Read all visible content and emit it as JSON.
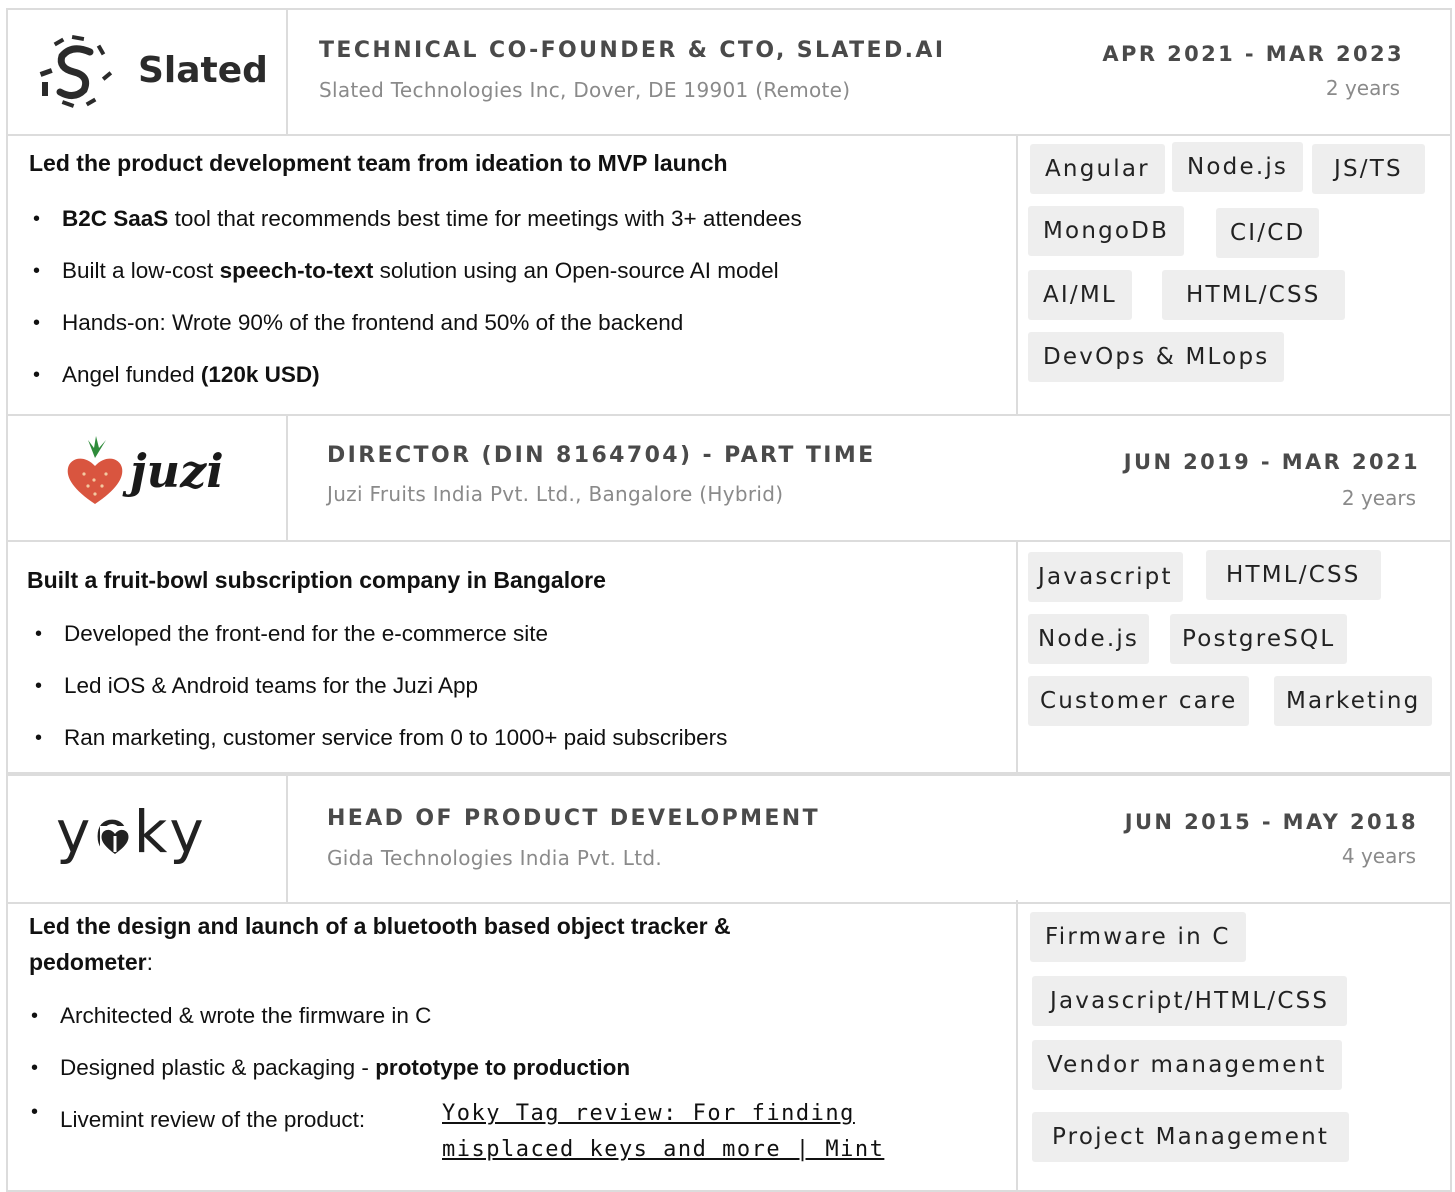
{
  "jobs": [
    {
      "logo_text": "Slated",
      "title": "TECHNICAL CO-FOUNDER & CTO, SLATED.AI",
      "company": "Slated Technologies Inc, Dover, DE 19901 (Remote)",
      "dates": "APR 2021 - MAR 2023",
      "duration": "2 years",
      "headline": "Led the product development team from ideation to MVP launch",
      "bullets": [
        {
          "bold_lead": "B2C SaaS",
          "text": " tool that recommends best time for meetings with 3+ attendees"
        },
        {
          "pre": "Built a low-cost ",
          "bold": "speech-to-text",
          "post": " solution using an Open-source AI model"
        },
        {
          "pre": "Hands-on: Wrote 90% of the frontend and 50% of the backend"
        },
        {
          "pre": "Angel funded ",
          "bold": "(120k USD)"
        }
      ],
      "tags": [
        "Angular",
        "Node.js",
        "JS/TS",
        "MongoDB",
        "CI/CD",
        "AI/ML",
        "HTML/CSS",
        "DevOps & MLops"
      ]
    },
    {
      "logo_text": "juzi",
      "title": "DIRECTOR (DIN 8164704) - PART TIME",
      "company": "Juzi Fruits India Pvt. Ltd., Bangalore (Hybrid)",
      "dates": "JUN 2019 - MAR 2021",
      "duration": "2 years",
      "headline": "Built a fruit-bowl subscription company in Bangalore",
      "bullets": [
        "Developed the front-end for the e-commerce site",
        "Led iOS & Android teams for the Juzi App",
        "Ran marketing, customer service from 0 to 1000+ paid subscribers"
      ],
      "tags": [
        "Javascript",
        "HTML/CSS",
        "Node.js",
        "PostgreSQL",
        "Customer care",
        "Marketing"
      ]
    },
    {
      "logo_text": "yoky",
      "title": "HEAD OF PRODUCT DEVELOPMENT",
      "company": "Gida Technologies India Pvt. Ltd.",
      "dates": "JUN 2015 - MAY 2018",
      "duration": "4 years",
      "headline_line1": "Led the design and launch of a bluetooth based object tracker &",
      "headline_line2": "pedometer",
      "headline_colon": ":",
      "bullets": [
        {
          "pre": "Architected & wrote the firmware in C"
        },
        {
          "pre": "Designed plastic & packaging - ",
          "bold": "prototype to production"
        },
        {
          "pre": "Livemint review of the product:  ",
          "link_line1": "Yoky Tag review: For finding ",
          "link_line2": "misplaced keys and more | Mint "
        }
      ],
      "tags": [
        "Firmware in C",
        "Javascript/HTML/CSS",
        "Vendor management",
        "Project Management"
      ]
    }
  ],
  "icons": {
    "slated": "slated-logo-icon",
    "juzi": "juzi-heart-icon",
    "yoky": "yoky-logo-icon"
  }
}
